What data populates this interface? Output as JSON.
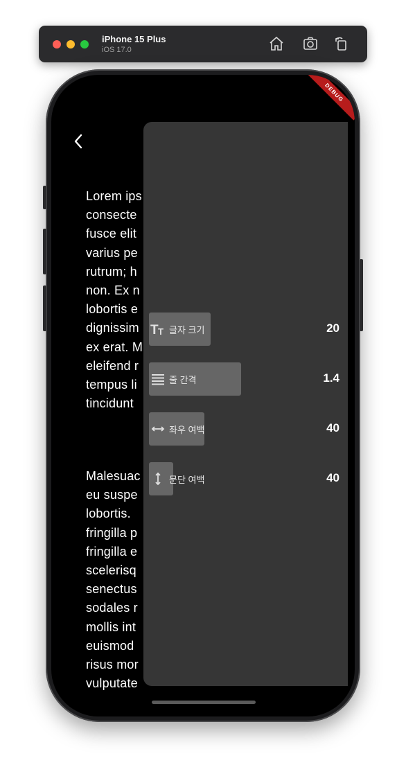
{
  "simulator": {
    "device": "iPhone 15 Plus",
    "os": "iOS 17.0"
  },
  "debug_banner": "DEBUG",
  "article": {
    "paragraph1": [
      "Lorem ips",
      "consecte",
      "fusce elit",
      "varius pe",
      "rutrum; h",
      "non. Ex n",
      "lobortis e",
      "dignissim",
      "ex erat. M",
      "eleifend r",
      "tempus li",
      "tincidunt"
    ],
    "paragraph2": [
      "Malesuac",
      "eu suspe",
      "lobortis.",
      "fringilla p",
      "fringilla e",
      "scelerisq",
      "senectus",
      "sodales r",
      "mollis int",
      "euismod",
      "risus mor",
      "vulputate"
    ]
  },
  "settings": [
    {
      "label": "글자 크기",
      "value": "20",
      "icon": "text-size-icon",
      "fill": 0.3
    },
    {
      "label": "줄 간격",
      "value": "1.4",
      "icon": "line-spacing-icon",
      "fill": 0.45
    },
    {
      "label": "좌우 여백",
      "value": "40",
      "icon": "horizontal-margin-icon",
      "fill": 0.27
    },
    {
      "label": "문단 여백",
      "value": "40",
      "icon": "paragraph-spacing-icon",
      "fill": 0.12
    }
  ]
}
